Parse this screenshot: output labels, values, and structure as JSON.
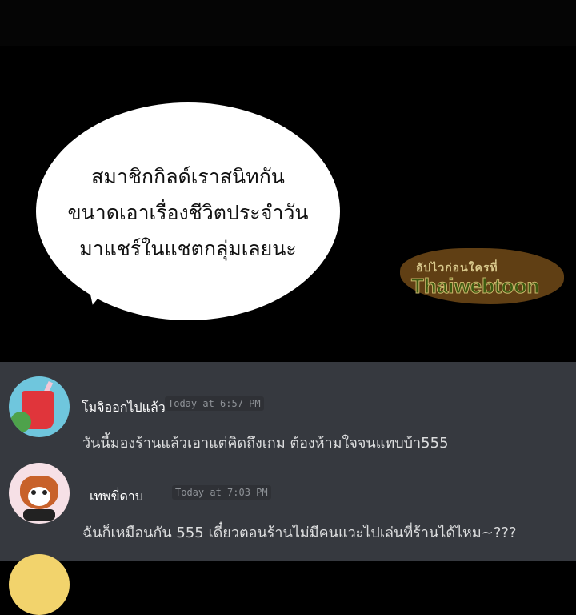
{
  "comic": {
    "speech_bubble_lines": [
      "สมาชิกกิลด์เราสนิทกัน",
      "ขนาดเอาเรื่องชีวิตประจำวัน",
      "มาแชร์ในแชตกลุ่มเลยนะ"
    ],
    "watermark": {
      "top_text": "อัปไวก่อนใครที่",
      "brand": "Thaiwebtoon"
    }
  },
  "messages": [
    {
      "username": "โมจิออกไปแล้ว",
      "timestamp": "Today at 6:57 PM",
      "text": "วันนี้มองร้านแล้วเอาแต่คิดถึงเกม ต้องห้ามใจจนแทบบ้า555"
    },
    {
      "username": "เทพขี่ดาบ",
      "timestamp": "Today at 7:03 PM",
      "text": "ฉันก็เหมือนกัน 555 เดี๋ยวตอนร้านไม่มีคนแวะไปเล่นที่ร้านได้ไหม~???"
    }
  ],
  "colors": {
    "chat_background": "#36393f",
    "message_text": "#dcddde",
    "timestamp_text": "#8e9297"
  }
}
